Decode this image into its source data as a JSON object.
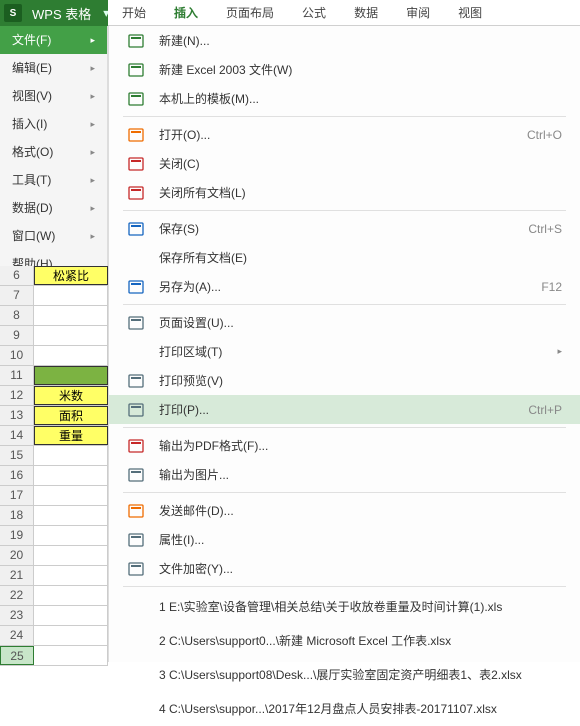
{
  "app": {
    "name": "WPS 表格",
    "dropdown_glyph": "▾"
  },
  "ribbon": {
    "tabs": [
      "开始",
      "插入",
      "页面布局",
      "公式",
      "数据",
      "审阅",
      "视图"
    ],
    "active_index": 1
  },
  "sidebar": {
    "items": [
      {
        "label": "文件(F)",
        "sub": true,
        "active": true
      },
      {
        "label": "编辑(E)",
        "sub": true
      },
      {
        "label": "视图(V)",
        "sub": true
      },
      {
        "label": "插入(I)",
        "sub": true
      },
      {
        "label": "格式(O)",
        "sub": true
      },
      {
        "label": "工具(T)",
        "sub": true
      },
      {
        "label": "数据(D)",
        "sub": true
      },
      {
        "label": "窗口(W)",
        "sub": true
      },
      {
        "label": "帮助(H)",
        "sub": false
      }
    ]
  },
  "sheet": {
    "rows": [
      {
        "n": "6",
        "txt": "松紧比",
        "cls": "yellow"
      },
      {
        "n": "7",
        "txt": "",
        "cls": ""
      },
      {
        "n": "8",
        "txt": "",
        "cls": ""
      },
      {
        "n": "9",
        "txt": "",
        "cls": ""
      },
      {
        "n": "10",
        "txt": "",
        "cls": ""
      },
      {
        "n": "11",
        "txt": "",
        "cls": "green"
      },
      {
        "n": "12",
        "txt": "米数",
        "cls": "yellow"
      },
      {
        "n": "13",
        "txt": "面积",
        "cls": "yellow"
      },
      {
        "n": "14",
        "txt": "重量",
        "cls": "yellow"
      },
      {
        "n": "15",
        "txt": "",
        "cls": ""
      },
      {
        "n": "16",
        "txt": "",
        "cls": ""
      },
      {
        "n": "17",
        "txt": "",
        "cls": ""
      },
      {
        "n": "18",
        "txt": "",
        "cls": ""
      },
      {
        "n": "19",
        "txt": "",
        "cls": ""
      },
      {
        "n": "20",
        "txt": "",
        "cls": ""
      },
      {
        "n": "21",
        "txt": "",
        "cls": ""
      },
      {
        "n": "22",
        "txt": "",
        "cls": ""
      },
      {
        "n": "23",
        "txt": "",
        "cls": ""
      },
      {
        "n": "24",
        "txt": "",
        "cls": ""
      },
      {
        "n": "25",
        "txt": "",
        "cls": "",
        "sel": true
      }
    ]
  },
  "menu": {
    "groups": [
      [
        {
          "icon": "new",
          "label": "新建(N)...",
          "shortcut": ""
        },
        {
          "icon": "new-x",
          "label": "新建 Excel 2003 文件(W)",
          "shortcut": ""
        },
        {
          "icon": "tpl",
          "label": "本机上的模板(M)...",
          "shortcut": ""
        }
      ],
      [
        {
          "icon": "open",
          "label": "打开(O)...",
          "shortcut": "Ctrl+O"
        },
        {
          "icon": "close",
          "label": "关闭(C)",
          "shortcut": ""
        },
        {
          "icon": "close-all",
          "label": "关闭所有文档(L)",
          "shortcut": ""
        }
      ],
      [
        {
          "icon": "save",
          "label": "保存(S)",
          "shortcut": "Ctrl+S"
        },
        {
          "icon": "",
          "label": "保存所有文档(E)",
          "shortcut": ""
        },
        {
          "icon": "saveas",
          "label": "另存为(A)...",
          "shortcut": "F12"
        }
      ],
      [
        {
          "icon": "page",
          "label": "页面设置(U)...",
          "shortcut": ""
        },
        {
          "icon": "",
          "label": "打印区域(T)",
          "shortcut": "",
          "sub": true
        },
        {
          "icon": "preview",
          "label": "打印预览(V)",
          "shortcut": ""
        },
        {
          "icon": "print",
          "label": "打印(P)...",
          "shortcut": "Ctrl+P",
          "highlight": true
        }
      ],
      [
        {
          "icon": "pdf",
          "label": "输出为PDF格式(F)...",
          "shortcut": ""
        },
        {
          "icon": "img",
          "label": "输出为图片...",
          "shortcut": ""
        }
      ],
      [
        {
          "icon": "mail",
          "label": "发送邮件(D)...",
          "shortcut": ""
        },
        {
          "icon": "prop",
          "label": "属性(I)...",
          "shortcut": ""
        },
        {
          "icon": "lock",
          "label": "文件加密(Y)...",
          "shortcut": ""
        }
      ]
    ],
    "recent": [
      "1  E:\\实验室\\设备管理\\相关总结\\关于收放卷重量及时间计算(1).xls",
      "2  C:\\Users\\support0...\\新建 Microsoft Excel 工作表.xlsx",
      "3  C:\\Users\\support08\\Desk...\\展厅实验室固定资产明细表1、表2.xlsx",
      "4  C:\\Users\\suppor...\\2017年12月盘点人员安排表-20171107.xlsx"
    ]
  },
  "icons": {
    "new": "#2e7d32",
    "new-x": "#2e7d32",
    "tpl": "#2e7d32",
    "open": "#ef6c00",
    "close": "#c62828",
    "close-all": "#c62828",
    "save": "#1565c0",
    "saveas": "#1565c0",
    "page": "#546e7a",
    "preview": "#546e7a",
    "print": "#546e7a",
    "pdf": "#c62828",
    "img": "#546e7a",
    "mail": "#ef6c00",
    "prop": "#546e7a",
    "lock": "#546e7a"
  }
}
